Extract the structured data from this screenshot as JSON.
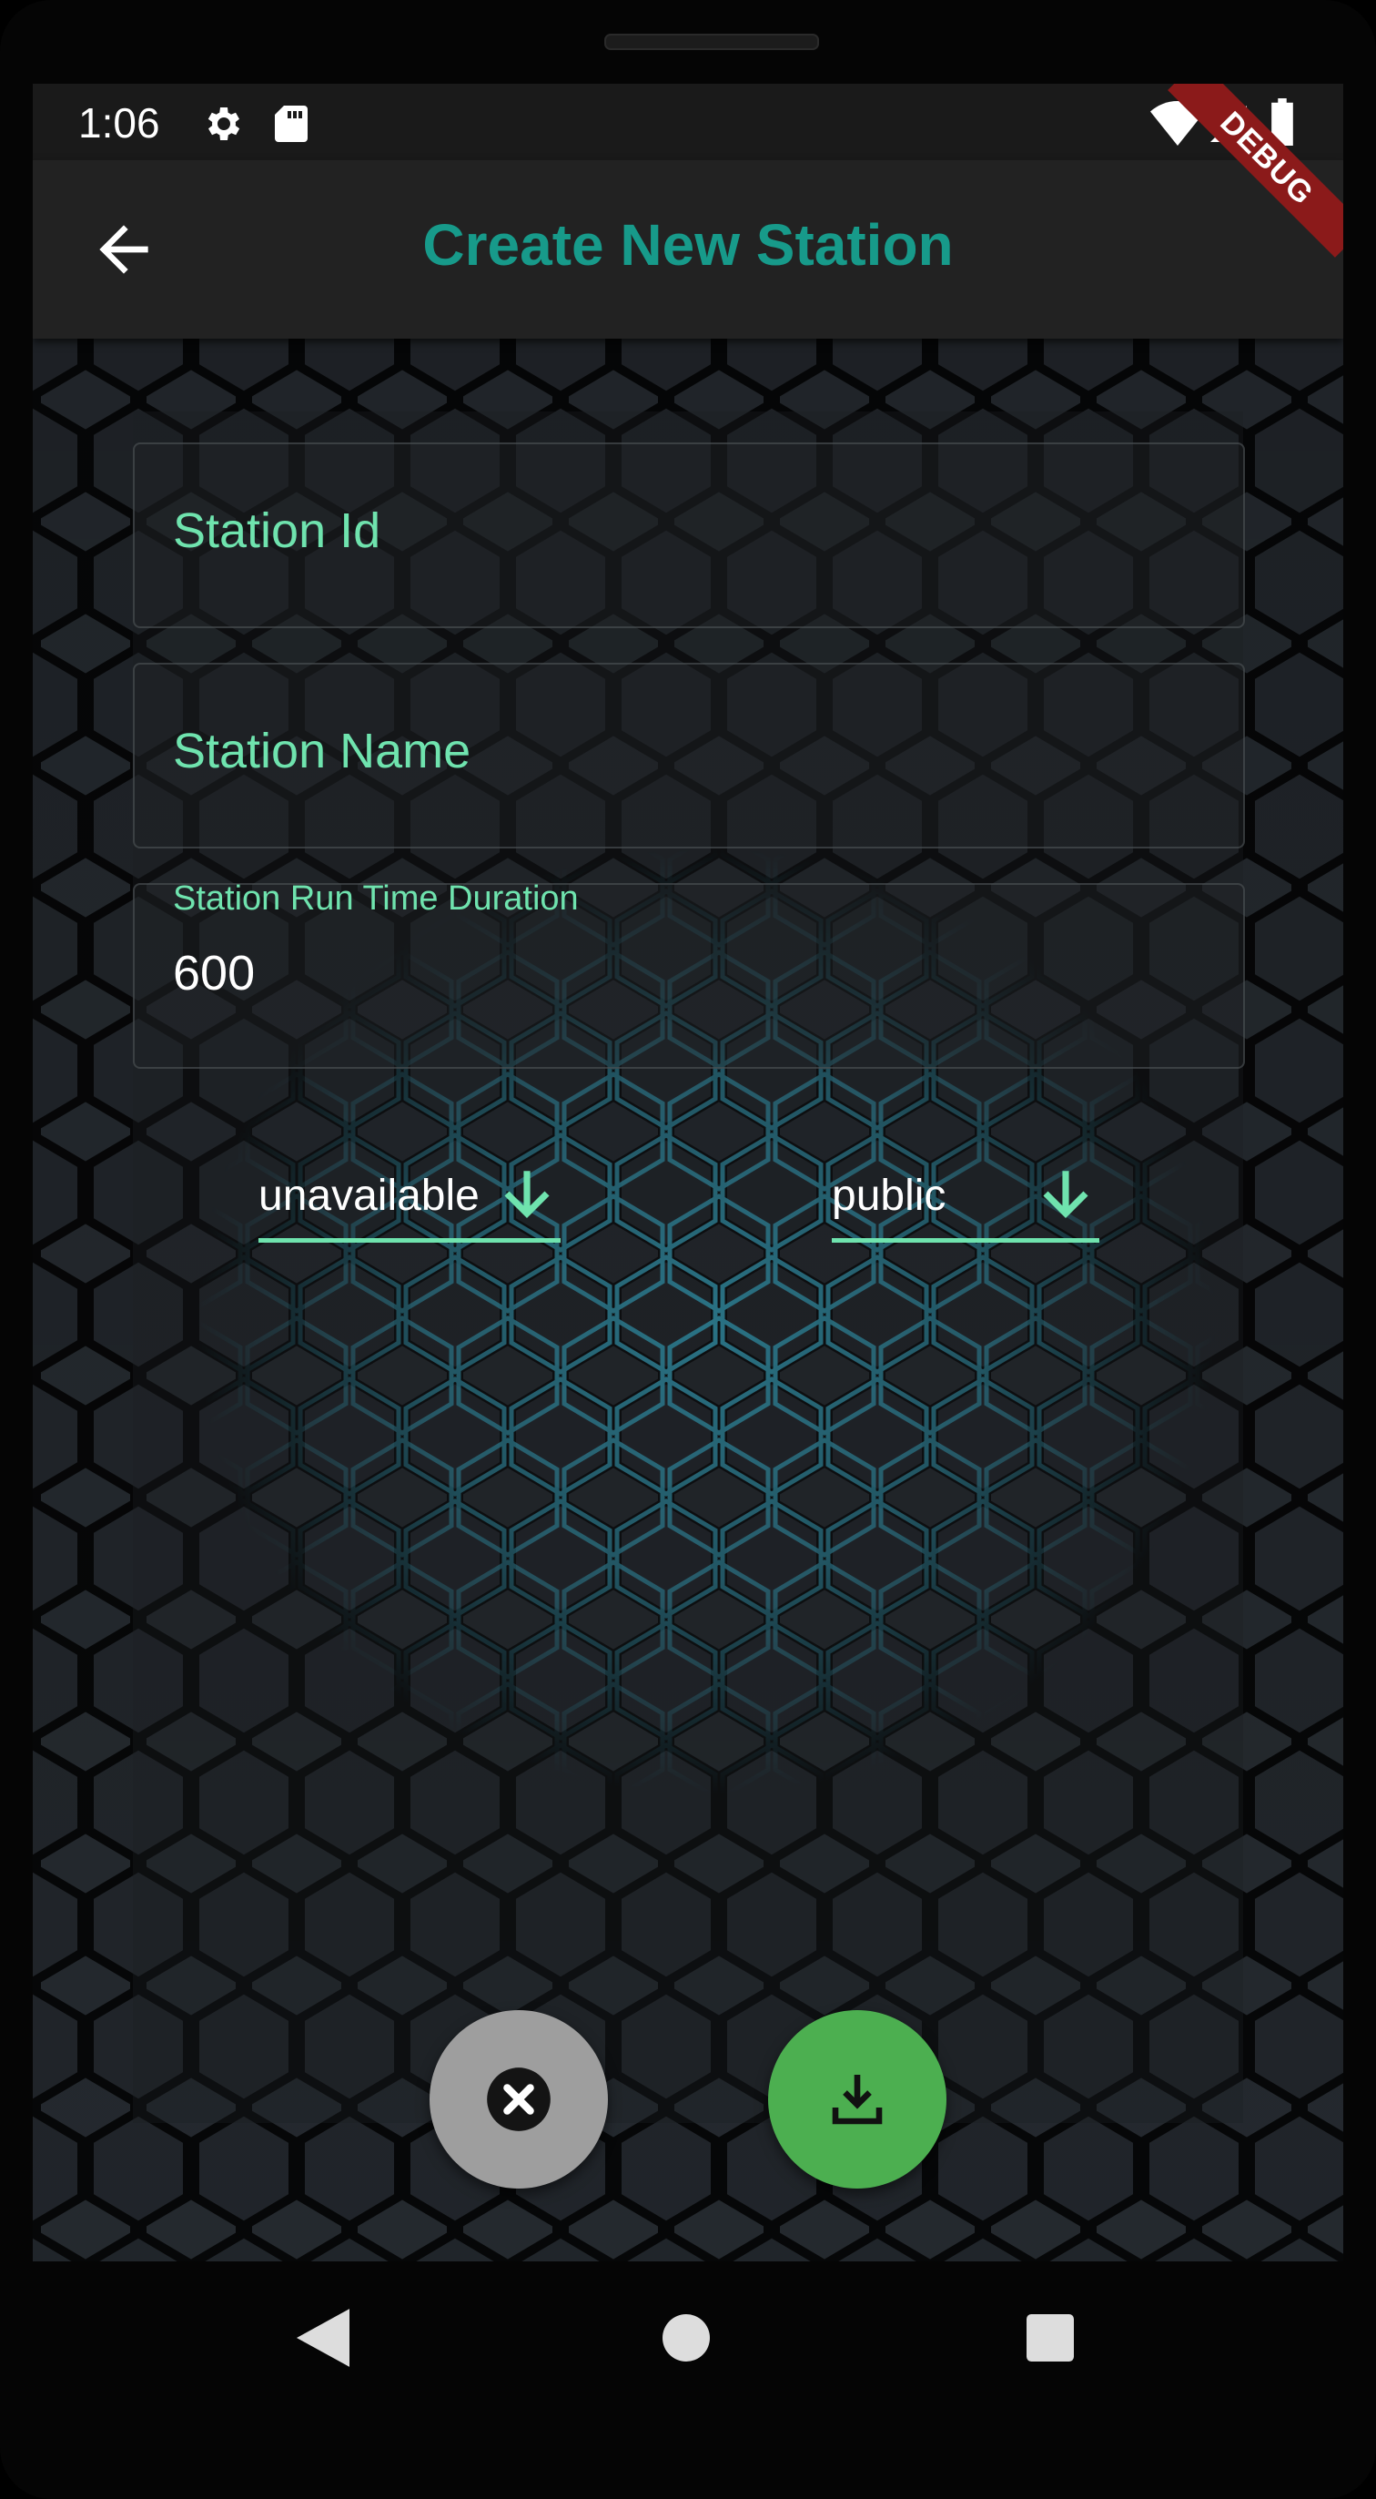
{
  "status_bar": {
    "time": "1:06",
    "icons": [
      "gear-icon",
      "sd-card-icon",
      "wifi-icon",
      "signal-icon",
      "battery-icon"
    ]
  },
  "app_bar": {
    "title": "Create New Station",
    "back_icon": "arrow-back-icon",
    "debug_banner": "DEBUG"
  },
  "form": {
    "station_id": {
      "placeholder": "Station Id",
      "value": ""
    },
    "station_name": {
      "placeholder": "Station Name",
      "value": ""
    },
    "run_time": {
      "label": "Station Run Time Duration",
      "value": "600"
    },
    "availability_dropdown": {
      "selected": "unavailable",
      "icon": "arrow-down-icon"
    },
    "visibility_dropdown": {
      "selected": "public",
      "icon": "arrow-down-icon"
    }
  },
  "actions": {
    "cancel": {
      "icon": "cancel-icon",
      "color": "#9e9e9e"
    },
    "save": {
      "icon": "download-icon",
      "color": "#4caf50"
    }
  },
  "colors": {
    "accent": "#6fe3ae",
    "title": "#179a8a",
    "appbar": "#222222",
    "hex_glow": "#29b6f6"
  },
  "nav_bar": {
    "icons": [
      "nav-back-icon",
      "nav-home-icon",
      "nav-recents-icon"
    ]
  }
}
